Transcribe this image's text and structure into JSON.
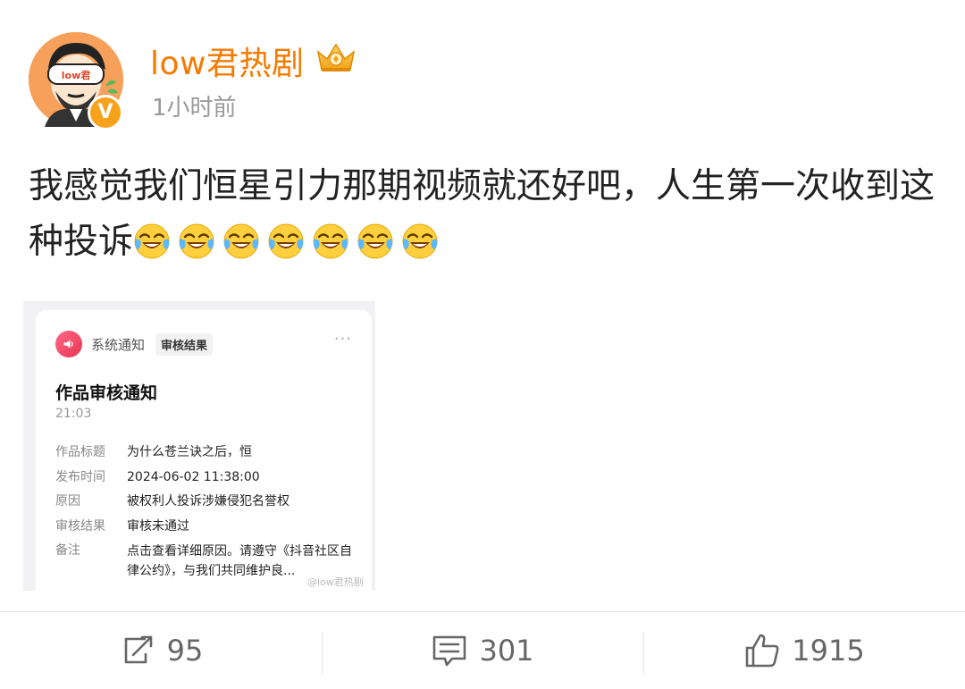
{
  "post": {
    "username": "low君热剧",
    "timestamp": "1小时前",
    "avatar_text": "low君",
    "verified_badge": "V",
    "text": "我感觉我们恒星引力那期视频就还好吧，人生第一次收到这种投诉",
    "emoji_name": "laugh-cry",
    "emoji_count": 7
  },
  "image": {
    "header_label": "系统通知",
    "tag": "审核结果",
    "more": "···",
    "title": "作品审核通知",
    "time": "21:03",
    "fields": [
      {
        "key": "作品标题",
        "value": "为什么苍兰诀之后，恒"
      },
      {
        "key": "发布时间",
        "value": "2024-06-02 11:38:00"
      },
      {
        "key": "原因",
        "value": "被权利人投诉涉嫌侵犯名誉权"
      },
      {
        "key": "审核结果",
        "value": "审核未通过"
      },
      {
        "key": "备注",
        "value": "点击查看详细原因。请遵守《抖音社区自律公约》，与我们共同维护良..."
      }
    ],
    "watermark": "@low君热剧"
  },
  "actions": {
    "repost": "95",
    "comment": "301",
    "like": "1915"
  },
  "colors": {
    "username": "#f57a00",
    "badge": "#f7a21b",
    "muted": "#999999"
  },
  "icons": [
    "repost-icon",
    "comment-icon",
    "like-icon",
    "crown-icon",
    "speaker-icon",
    "laugh-cry-emoji"
  ]
}
